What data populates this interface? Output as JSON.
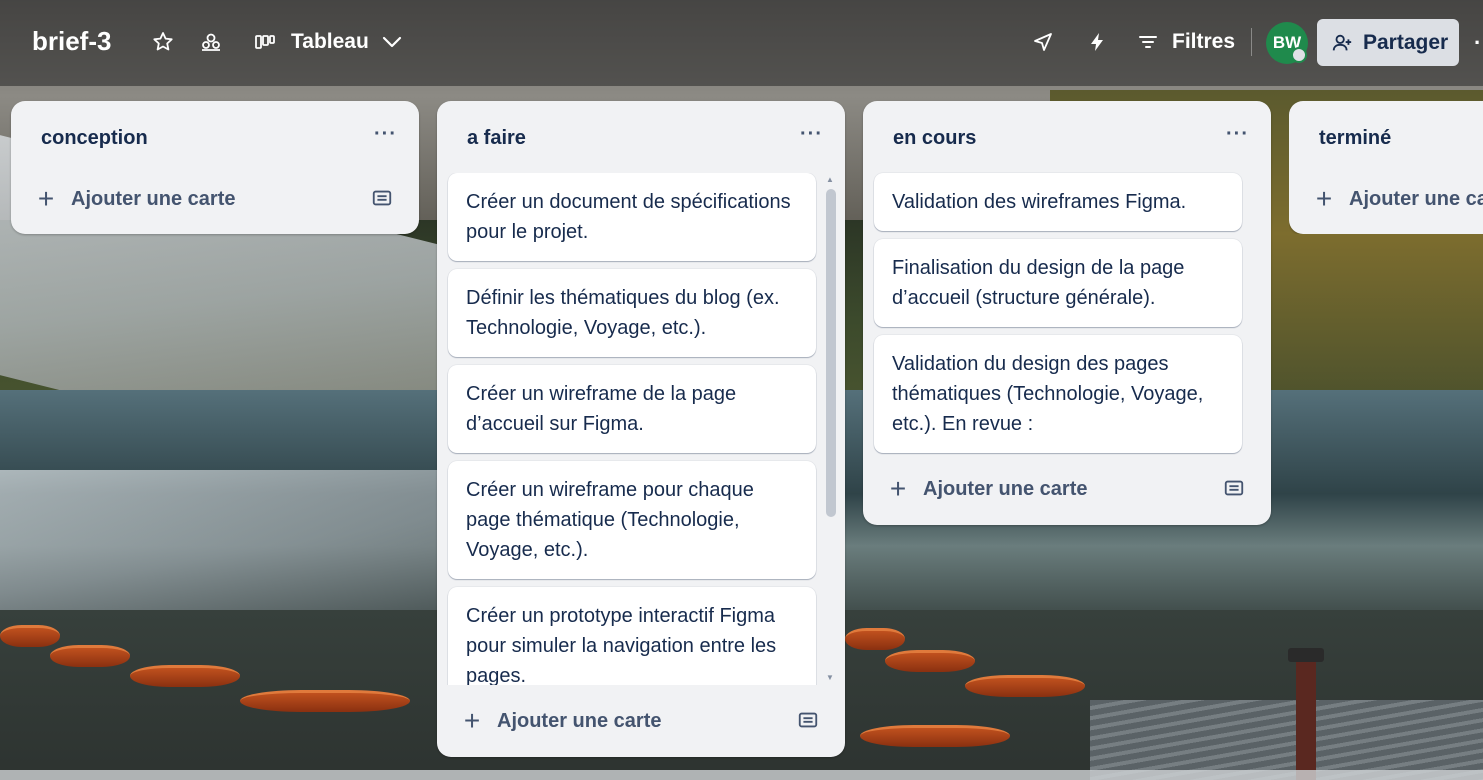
{
  "header": {
    "board_title": "brief-3",
    "star_icon": "star-icon",
    "workspace_icon": "workspace-visibility-icon",
    "view_icon": "board-view-icon",
    "view_label": "Tableau",
    "view_chevron": "chevron-down-icon",
    "power_up_icon": "rocket-icon",
    "automation_icon": "lightning-icon",
    "filter_icon": "filter-icon",
    "filter_label": "Filtres",
    "avatar_initials": "BW",
    "share_icon": "add-person-icon",
    "share_label": "Partager",
    "more_icon": "more-dots-icon"
  },
  "lists": [
    {
      "title": "conception",
      "menu": "···",
      "cards": [],
      "add_card_label": "Ajouter une carte"
    },
    {
      "title": "a faire",
      "menu": "···",
      "cards": [
        "Créer un document de spécifications pour le projet.",
        "Définir les thématiques du blog (ex. Technologie, Voyage, etc.).",
        "Créer un wireframe de la page d’accueil sur Figma.",
        "Créer un wireframe pour chaque page thématique (Technologie, Voyage, etc.).",
        "Créer un prototype interactif Figma pour simuler la navigation entre les pages."
      ],
      "add_card_label": "Ajouter une carte"
    },
    {
      "title": "en cours",
      "menu": "···",
      "cards": [
        "Validation des wireframes Figma.",
        "Finalisation du design de la page d’accueil (structure générale).",
        "Validation du design des pages thématiques (Technologie, Voyage, etc.). En revue :"
      ],
      "add_card_label": "Ajouter une carte"
    },
    {
      "title": "terminé",
      "cards": [],
      "add_card_label": "Ajouter une carte"
    }
  ],
  "colors": {
    "list_bg": "#f1f2f4",
    "card_bg": "#ffffff",
    "text": "#172b4d",
    "avatar_bg": "#1f8a4c",
    "share_bg": "#dcdfe4"
  }
}
